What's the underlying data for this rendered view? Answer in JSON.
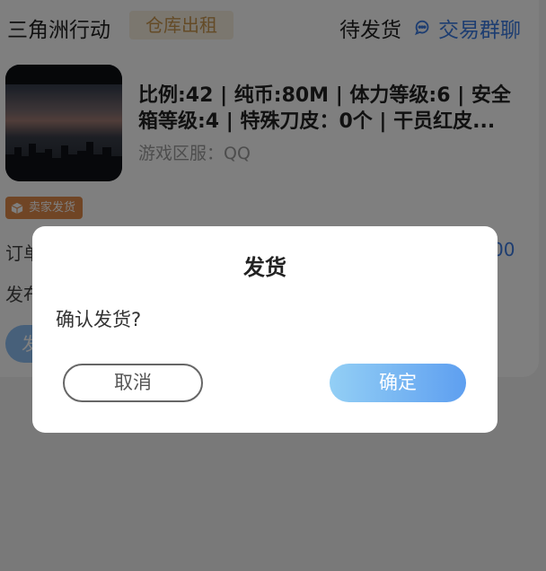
{
  "header": {
    "game_title": "三角洲行动",
    "rent_tag": "仓库出租",
    "status": "待发货",
    "group_chat": "交易群聊"
  },
  "item": {
    "description": "比例:42 | 纯币:80M | 体力等级:6 | 安全箱等级:4 | 特殊刀皮：0个 | 干员红皮...",
    "server": "游戏区服：QQ"
  },
  "badge": {
    "seller_ship": "卖家发货"
  },
  "order": {
    "order_label": "订单",
    "order_number_partial": "00",
    "publish_label": "发布",
    "ship_button_partial": "发"
  },
  "dialog": {
    "title": "发货",
    "message": "确认发货?",
    "cancel": "取消",
    "confirm": "确定"
  },
  "colors": {
    "accent_blue": "#3a7be3",
    "rent_tag_bg": "#f7eedf",
    "rent_tag_text": "#c9964f",
    "seller_badge_bg": "#e08a4a"
  }
}
